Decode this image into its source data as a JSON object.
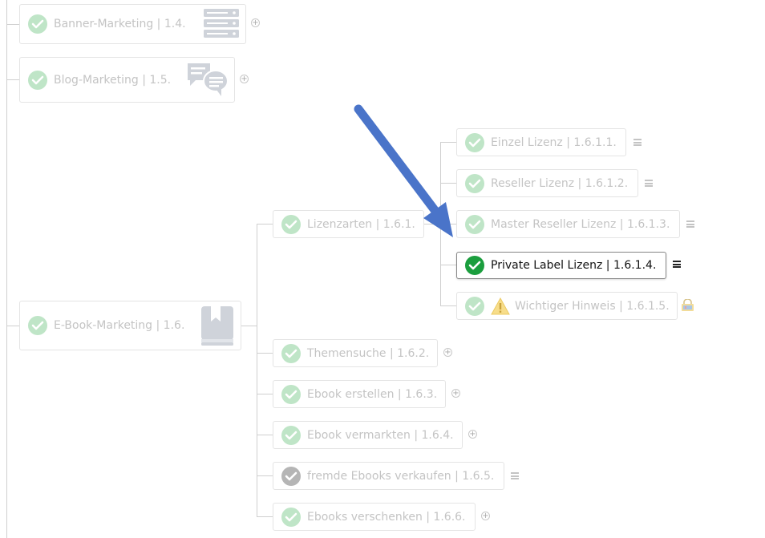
{
  "nodes": {
    "banner": "Banner-Marketing | 1.4.",
    "blog": "Blog-Marketing | 1.5.",
    "ebook": "E-Book-Marketing | 1.6.",
    "lizenzarten": "Lizenzarten | 1.6.1.",
    "einzel": "Einzel Lizenz | 1.6.1.1.",
    "reseller": "Reseller Lizenz | 1.6.1.2.",
    "master": "Master Reseller Lizenz | 1.6.1.3.",
    "private": "Private Label Lizenz | 1.6.1.4.",
    "hinweis": "Wichtiger Hinweis | 1.6.1.5.",
    "themensuche": "Themensuche | 1.6.2.",
    "erstellen": "Ebook erstellen | 1.6.3.",
    "vermarkten": "Ebook vermarkten | 1.6.4.",
    "fremde": "fremde Ebooks verkaufen | 1.6.5.",
    "verschenken": "Ebooks verschenken | 1.6.6."
  },
  "icons": {
    "check": "check-circle-icon",
    "server": "server-icon",
    "chat": "chat-bubbles-icon",
    "book": "bookmark-book-icon",
    "warning": "warning-icon",
    "lock": "lock-icon",
    "expand": "plus-circle-icon",
    "menu": "hamburger-menu-icon",
    "arrow": "annotation-arrow"
  },
  "colors": {
    "active_check": "#1b9e3e",
    "faded_check": "#bfe5c7",
    "gray_check": "#b5b5b5",
    "arrow": "#4a74c9"
  }
}
